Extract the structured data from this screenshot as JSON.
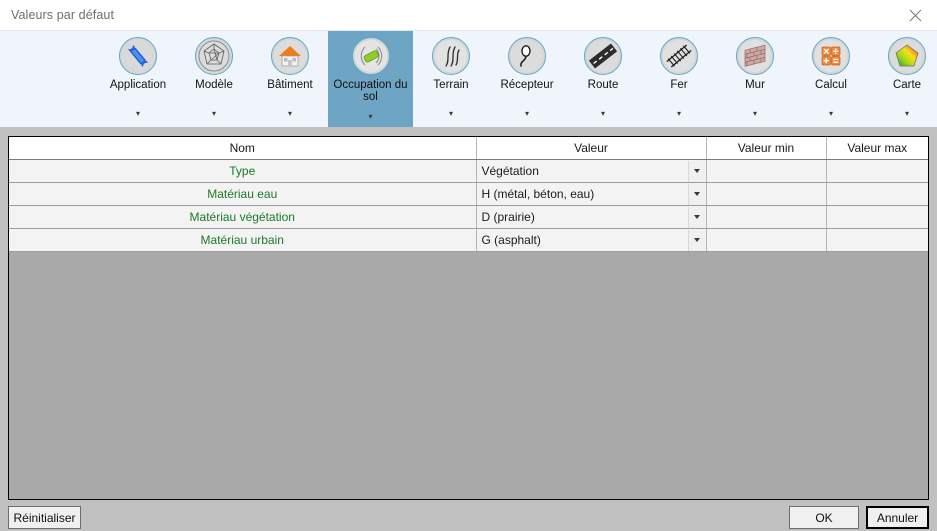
{
  "window": {
    "title": "Valeurs par défaut",
    "close_icon": "close-icon"
  },
  "ribbon": {
    "items": [
      {
        "label": "Application",
        "icon": "wrench-icon",
        "caret": "▾",
        "selected": false
      },
      {
        "label": "Modèle",
        "icon": "mesh-globe-icon",
        "caret": "▾",
        "selected": false
      },
      {
        "label": "Bâtiment",
        "icon": "building-icon",
        "caret": "▾",
        "selected": false
      },
      {
        "label": "Occupation du sol",
        "icon": "land-use-icon",
        "caret": "▾",
        "selected": true
      },
      {
        "label": "Terrain",
        "icon": "terrain-icon",
        "caret": "▾",
        "selected": false
      },
      {
        "label": "Récepteur",
        "icon": "receiver-icon",
        "caret": "▾",
        "selected": false
      },
      {
        "label": "Route",
        "icon": "road-icon",
        "caret": "▾",
        "selected": false
      },
      {
        "label": "Fer",
        "icon": "railway-icon",
        "caret": "▾",
        "selected": false
      },
      {
        "label": "Mur",
        "icon": "wall-icon",
        "caret": "▾",
        "selected": false
      },
      {
        "label": "Calcul",
        "icon": "calculator-icon",
        "caret": "▾",
        "selected": false
      },
      {
        "label": "Carte",
        "icon": "colormap-icon",
        "caret": "▾",
        "selected": false
      }
    ]
  },
  "table": {
    "columns": [
      "Nom",
      "Valeur",
      "Valeur min",
      "Valeur max"
    ],
    "rows": [
      {
        "name": "Type",
        "value": "Végétation",
        "min": "",
        "max": ""
      },
      {
        "name": "Matériau eau",
        "value": "H (métal, béton, eau)",
        "min": "",
        "max": ""
      },
      {
        "name": "Matériau végétation",
        "value": "D (prairie)",
        "min": "",
        "max": ""
      },
      {
        "name": "Matériau urbain",
        "value": "G (asphalt)",
        "min": "",
        "max": ""
      }
    ]
  },
  "buttons": {
    "reset": "Réinitialiser",
    "ok": "OK",
    "cancel": "Annuler"
  },
  "colors": {
    "selected_tab": "#6ea4c4",
    "ribbon_bg": "#f0f5fc",
    "name_text": "#1a7a28",
    "body_bg": "#c0c0c0",
    "title_text": "#6f6f6f"
  }
}
